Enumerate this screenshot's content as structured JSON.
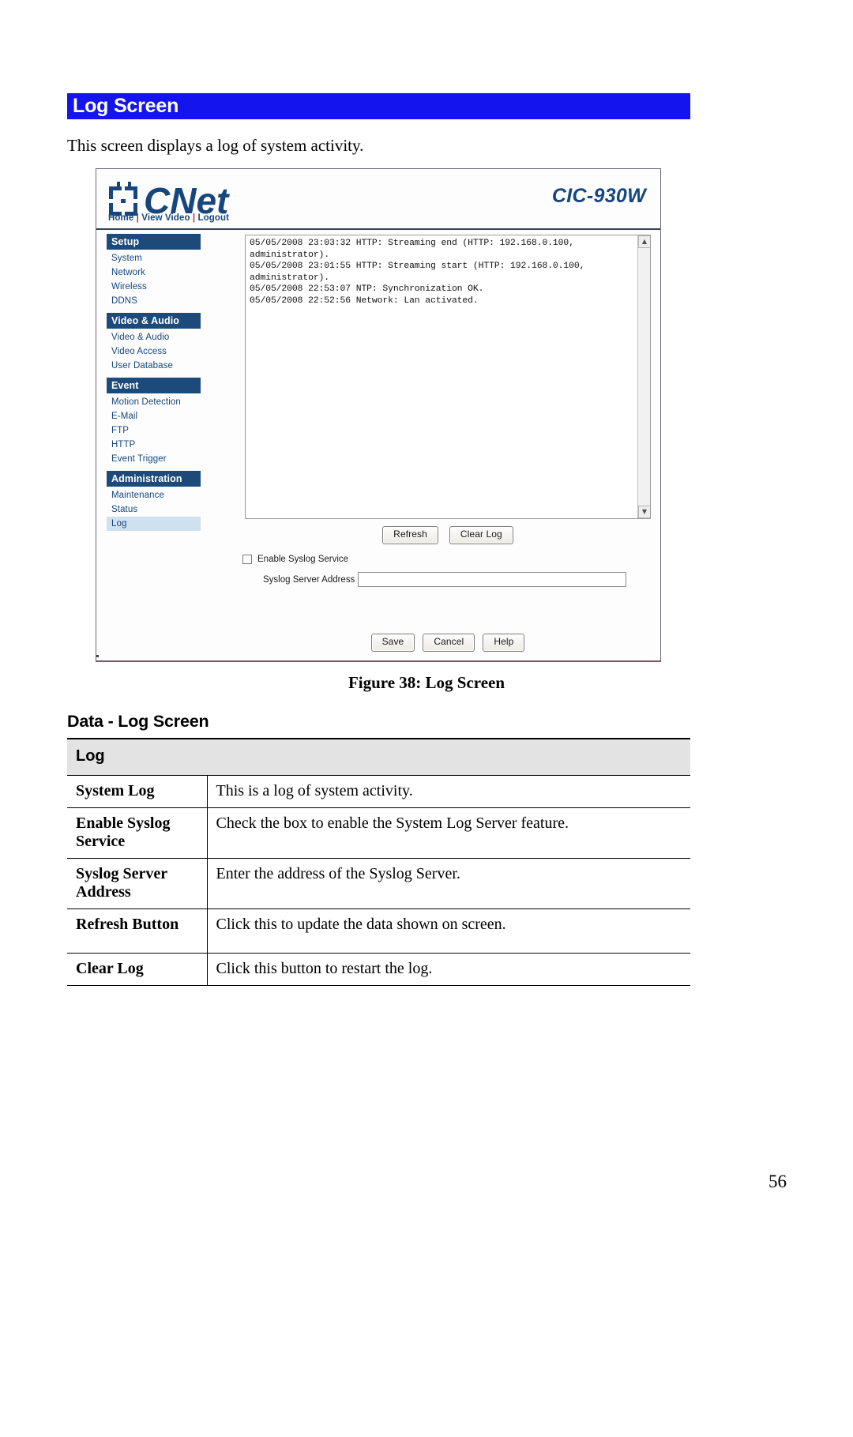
{
  "section": {
    "title": "Log Screen",
    "intro": "This screen displays a log of system activity."
  },
  "device_ui": {
    "brand": "CNet",
    "model": "CIC-930W",
    "nav": {
      "home": "Home",
      "view_video": "View Video",
      "logout": "Logout",
      "separator": "|"
    },
    "sidebar": [
      {
        "type": "group",
        "label": "Setup"
      },
      {
        "type": "item",
        "label": "System"
      },
      {
        "type": "item",
        "label": "Network"
      },
      {
        "type": "item",
        "label": "Wireless"
      },
      {
        "type": "item",
        "label": "DDNS"
      },
      {
        "type": "group",
        "label": "Video & Audio"
      },
      {
        "type": "item",
        "label": "Video & Audio"
      },
      {
        "type": "item",
        "label": "Video Access"
      },
      {
        "type": "item",
        "label": "User Database"
      },
      {
        "type": "group",
        "label": "Event"
      },
      {
        "type": "item",
        "label": "Motion Detection"
      },
      {
        "type": "item",
        "label": "E-Mail"
      },
      {
        "type": "item",
        "label": "FTP"
      },
      {
        "type": "item",
        "label": "HTTP"
      },
      {
        "type": "item",
        "label": "Event Trigger"
      },
      {
        "type": "group",
        "label": "Administration"
      },
      {
        "type": "item",
        "label": "Maintenance"
      },
      {
        "type": "item",
        "label": "Status"
      },
      {
        "type": "item",
        "label": "Log",
        "selected": true
      }
    ],
    "log_text": "05/05/2008 23:03:32 HTTP: Streaming end (HTTP: 192.168.0.100,\nadministrator).\n05/05/2008 23:01:55 HTTP: Streaming start (HTTP: 192.168.0.100,\nadministrator).\n05/05/2008 22:53:07 NTP: Synchronization OK.\n05/05/2008 22:52:56 Network: Lan activated.",
    "buttons": {
      "refresh": "Refresh",
      "clear_log": "Clear Log",
      "save": "Save",
      "cancel": "Cancel",
      "help": "Help"
    },
    "syslog": {
      "enable_label": "Enable Syslog Service",
      "enable_checked": false,
      "address_label": "Syslog Server Address",
      "address_value": "",
      "address_placeholder": ""
    },
    "scrollbar": {
      "up_arrow": "▲",
      "down_arrow": "▼"
    }
  },
  "figure_caption": "Figure 38: Log Screen",
  "data_section": {
    "heading": "Data - Log Screen",
    "table_header": "Log",
    "rows": [
      {
        "label": "System Log",
        "description": "This is a log of system activity."
      },
      {
        "label": "Enable Syslog Service",
        "description": "Check the box to enable the System Log Server feature."
      },
      {
        "label": "Syslog Server Address",
        "description": "Enter the address of the Syslog Server."
      },
      {
        "label": "Refresh Button",
        "description": "Click this to update the data shown on screen."
      },
      {
        "label": "Clear Log",
        "description": "Click this button to restart the log."
      }
    ]
  },
  "page_number": "56"
}
